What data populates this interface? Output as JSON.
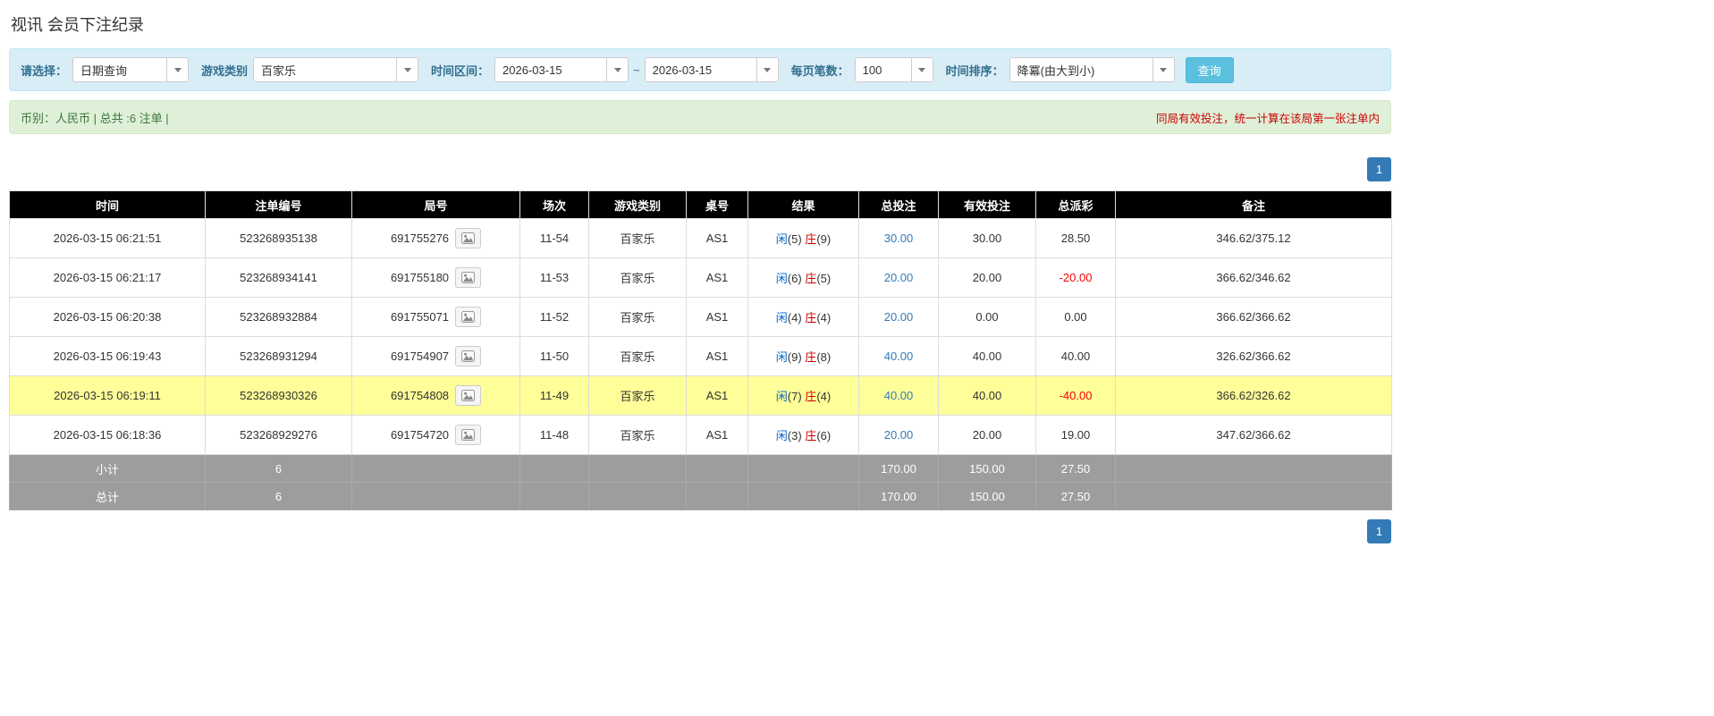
{
  "page": {
    "title": "视讯 会员下注纪录"
  },
  "filters": {
    "select_label": "请选择：",
    "select_value": "日期查询",
    "game_type_label": "游戏类别",
    "game_type_value": "百家乐",
    "date_range_label": "时间区间：",
    "date_from": "2026-03-15",
    "range_separator": "~",
    "date_to": "2026-03-15",
    "page_size_label": "每页笔数：",
    "page_size_value": "100",
    "sort_label": "时间排序：",
    "sort_value": "降冪(由大到小)",
    "search_button": "查询"
  },
  "summary": {
    "left": "币别：人民币 | 总共 :6 注单 |",
    "right": "同局有效投注，统一计算在该局第一张注单内"
  },
  "pagination": {
    "page": "1"
  },
  "colors": {
    "accent_blue": "#337ab7",
    "player_blue": "#0066cc",
    "banker_red": "#cc0000",
    "negative_red": "#ff0000",
    "highlight_yellow": "#ffff99",
    "header_black": "#000000",
    "filter_bar_bg": "#d9edf7",
    "summary_bar_bg": "#dff0d8",
    "search_button_bg": "#5bc0de",
    "summary_row_bg": "#9d9d9d"
  },
  "table": {
    "headers": [
      "时间",
      "注单编号",
      "局号",
      "场次",
      "游戏类别",
      "桌号",
      "结果",
      "总投注",
      "有效投注",
      "总派彩",
      "备注"
    ],
    "rows": [
      {
        "time": "2026-03-15 06:21:51",
        "bet_id": "523268935138",
        "round_id": "691755276",
        "session": "11-54",
        "game": "百家乐",
        "table_no": "AS1",
        "player": "闲",
        "player_pts": "(5)",
        "banker": "庄",
        "banker_pts": "(9)",
        "total_bet": "30.00",
        "valid_bet": "30.00",
        "payout": "28.50",
        "note": "346.62/375.12",
        "highlight": false
      },
      {
        "time": "2026-03-15 06:21:17",
        "bet_id": "523268934141",
        "round_id": "691755180",
        "session": "11-53",
        "game": "百家乐",
        "table_no": "AS1",
        "player": "闲",
        "player_pts": "(6)",
        "banker": "庄",
        "banker_pts": "(5)",
        "total_bet": "20.00",
        "valid_bet": "20.00",
        "payout": "-20.00",
        "note": "366.62/346.62",
        "highlight": false
      },
      {
        "time": "2026-03-15 06:20:38",
        "bet_id": "523268932884",
        "round_id": "691755071",
        "session": "11-52",
        "game": "百家乐",
        "table_no": "AS1",
        "player": "闲",
        "player_pts": "(4)",
        "banker": "庄",
        "banker_pts": "(4)",
        "total_bet": "20.00",
        "valid_bet": "0.00",
        "payout": "0.00",
        "note": "366.62/366.62",
        "highlight": false
      },
      {
        "time": "2026-03-15 06:19:43",
        "bet_id": "523268931294",
        "round_id": "691754907",
        "session": "11-50",
        "game": "百家乐",
        "table_no": "AS1",
        "player": "闲",
        "player_pts": "(9)",
        "banker": "庄",
        "banker_pts": "(8)",
        "total_bet": "40.00",
        "valid_bet": "40.00",
        "payout": "40.00",
        "note": "326.62/366.62",
        "highlight": false
      },
      {
        "time": "2026-03-15 06:19:11",
        "bet_id": "523268930326",
        "round_id": "691754808",
        "session": "11-49",
        "game": "百家乐",
        "table_no": "AS1",
        "player": "闲",
        "player_pts": "(7)",
        "banker": "庄",
        "banker_pts": "(4)",
        "total_bet": "40.00",
        "valid_bet": "40.00",
        "payout": "-40.00",
        "note": "366.62/326.62",
        "highlight": true
      },
      {
        "time": "2026-03-15 06:18:36",
        "bet_id": "523268929276",
        "round_id": "691754720",
        "session": "11-48",
        "game": "百家乐",
        "table_no": "AS1",
        "player": "闲",
        "player_pts": "(3)",
        "banker": "庄",
        "banker_pts": "(6)",
        "total_bet": "20.00",
        "valid_bet": "20.00",
        "payout": "19.00",
        "note": "347.62/366.62",
        "highlight": false
      }
    ],
    "subtotal": {
      "label": "小计",
      "count": "6",
      "total_bet": "170.00",
      "valid_bet": "150.00",
      "payout": "27.50"
    },
    "total": {
      "label": "总计",
      "count": "6",
      "total_bet": "170.00",
      "valid_bet": "150.00",
      "payout": "27.50"
    }
  }
}
